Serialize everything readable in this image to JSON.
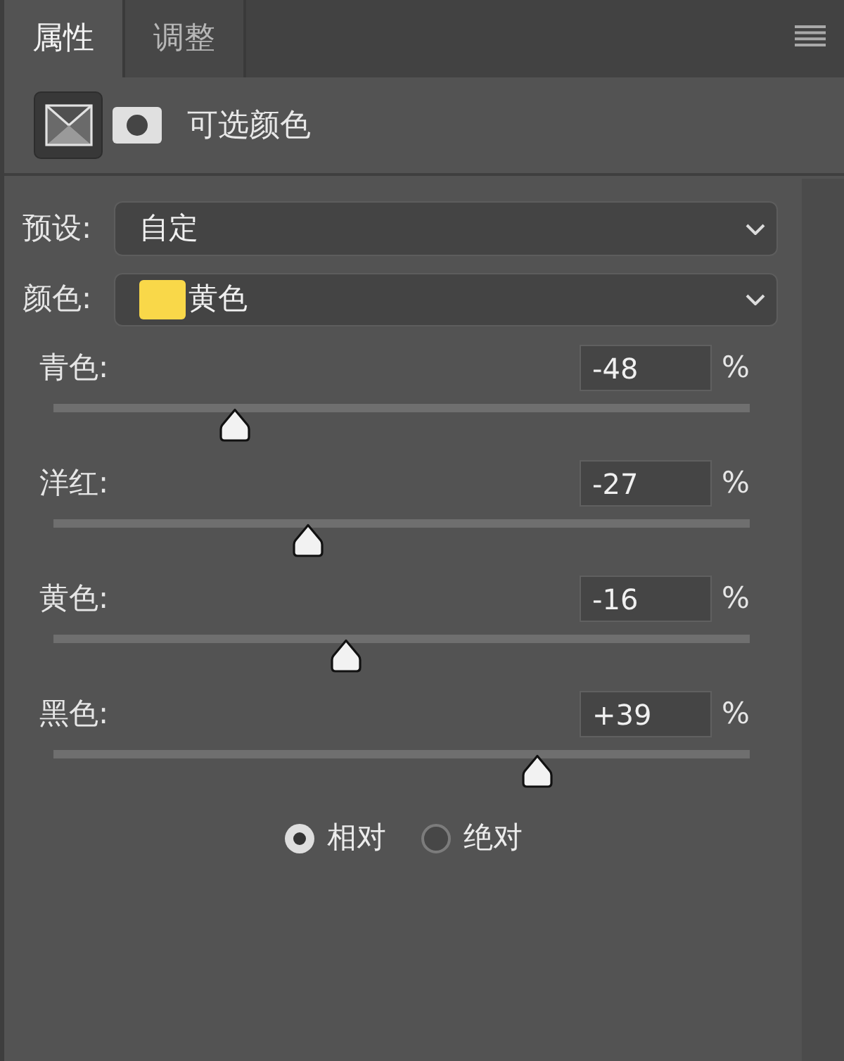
{
  "tabs": [
    {
      "label": "属性",
      "selected": true
    },
    {
      "label": "调整",
      "selected": false
    }
  ],
  "header": {
    "buttons": [
      {
        "kind": "adjustment",
        "selected": true
      },
      {
        "kind": "mask",
        "selected": false
      }
    ],
    "title": "可选颜色"
  },
  "preset": {
    "label": "预设:",
    "value": "自定"
  },
  "color_field": {
    "label": "颜色:",
    "value": "黄色",
    "color": "#f9d849"
  },
  "sliders": [
    {
      "label": "青色:",
      "value": "-48",
      "unit": "%",
      "level": 0.26
    },
    {
      "label": "洋红:",
      "value": "-27",
      "unit": "%",
      "level": 0.365
    },
    {
      "label": "黄色:",
      "value": "-16",
      "unit": "%",
      "level": 0.42
    },
    {
      "label": "黑色:",
      "value": "+39",
      "unit": "%",
      "level": 0.695
    }
  ],
  "modes": [
    {
      "label": "相对",
      "selected": true
    },
    {
      "label": "绝对",
      "selected": false
    }
  ]
}
